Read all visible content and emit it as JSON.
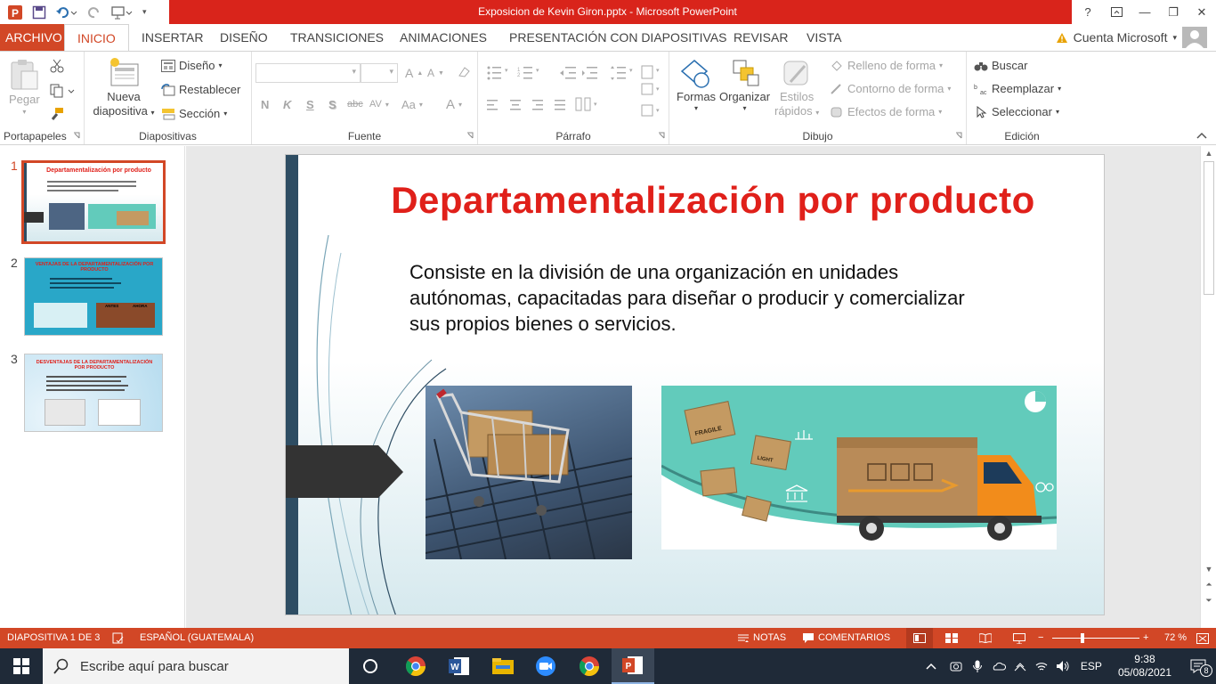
{
  "window": {
    "title": "Exposicion de Kevin Giron.pptx -  Microsoft PowerPoint",
    "controls": {
      "help": "?",
      "minimize": "—",
      "restore": "❐",
      "close": "✕"
    }
  },
  "tabs": [
    {
      "label": "ARCHIVO"
    },
    {
      "label": "INICIO"
    },
    {
      "label": "INSERTAR"
    },
    {
      "label": "DISEÑO"
    },
    {
      "label": "TRANSICIONES"
    },
    {
      "label": "ANIMACIONES"
    },
    {
      "label": "PRESENTACIÓN CON DIAPOSITIVAS"
    },
    {
      "label": "REVISAR"
    },
    {
      "label": "VISTA"
    }
  ],
  "account": {
    "label": "Cuenta Microsoft"
  },
  "ribbon": {
    "portapapeles": {
      "label": "Portapapeles",
      "paste": "Pegar"
    },
    "diapositivas": {
      "label": "Diapositivas",
      "new1": "Nueva",
      "new2": "diapositiva",
      "layout": "Diseño",
      "reset": "Restablecer",
      "section": "Sección"
    },
    "fuente": {
      "label": "Fuente",
      "bold": "N",
      "italic": "K",
      "underline": "S",
      "shadow": "S",
      "strike": "abc",
      "spacing": "AV",
      "case": "Aa",
      "color": "A"
    },
    "parrafo": {
      "label": "Párrafo"
    },
    "dibujo": {
      "label": "Dibujo",
      "shapes": "Formas",
      "arrange": "Organizar",
      "styles1": "Estilos",
      "styles2": "rápidos",
      "fill": "Relleno de forma",
      "outline": "Contorno de forma",
      "effects": "Efectos de forma"
    },
    "edicion": {
      "label": "Edición",
      "find": "Buscar",
      "replace": "Reemplazar",
      "select": "Seleccionar"
    }
  },
  "thumbnails": [
    {
      "num": "1",
      "title": "Departamentalización por producto",
      "selected": true
    },
    {
      "num": "2",
      "title": "VENTAJAS DE LA DEPARTAMENTALIZACIÓN POR PRODUCTO",
      "tag1": "ANTES",
      "tag2": "AHORA"
    },
    {
      "num": "3",
      "title": "DESVENTAJAS DE LA DEPARTAMENTALIZACIÓN POR PRODUCTO"
    }
  ],
  "slide": {
    "title": "Departamentalización por producto",
    "body": "Consiste en la división de una organización en unidades autónomas, capacitadas para diseñar o producir y comercializar sus propios bienes o servicios.",
    "box_label_fragile": "FRAGILE",
    "box_label_light": "LIGHT"
  },
  "status": {
    "slide_info": "DIAPOSITIVA 1 DE 3",
    "language": "ESPAÑOL (GUATEMALA)",
    "notes": "NOTAS",
    "comments": "COMENTARIOS",
    "zoom": "72 %",
    "zoom_value": 72
  },
  "taskbar": {
    "search_placeholder": "Escribe aquí para buscar",
    "lang": "ESP",
    "time": "9:38",
    "date": "05/08/2021",
    "notifications": "8"
  },
  "colors": {
    "accent": "#d24726",
    "titlebar": "#d9241b",
    "slide_title": "#e0201a",
    "taskbar": "#1f2a38"
  }
}
